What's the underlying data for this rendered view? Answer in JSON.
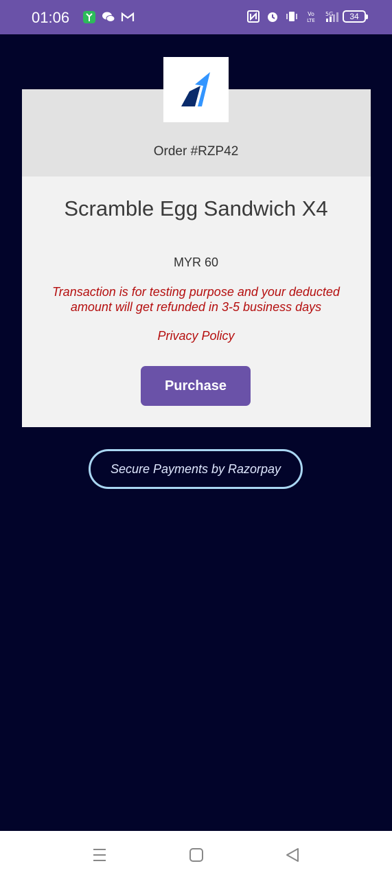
{
  "status_bar": {
    "time": "01:06",
    "battery": "34",
    "left_icons": [
      "app-notification-icon",
      "wechat-icon",
      "gmail-icon"
    ],
    "right_icons": [
      "nfc-icon",
      "alarm-icon",
      "vibrate-icon",
      "volte-icon",
      "signal-5g-icon",
      "battery-icon"
    ],
    "volte_label": "Vo LTE",
    "network_label": "5G"
  },
  "order": {
    "id": "Order #RZP42",
    "product": "Scramble Egg Sandwich X4",
    "amount": "MYR 60",
    "disclaimer": "Transaction is for testing purpose and your deducted amount will get refunded in 3-5 business days",
    "privacy_link": "Privacy Policy",
    "purchase_label": "Purchase"
  },
  "footer": {
    "secure_label": "Secure Payments by Razorpay"
  },
  "nav": {
    "icons": [
      "menu-icon",
      "home-icon",
      "back-icon"
    ]
  },
  "colors": {
    "accent": "#6a52a8",
    "background": "#02042a",
    "error_text": "#b50f0f",
    "pill_border": "#a9d6f2"
  }
}
